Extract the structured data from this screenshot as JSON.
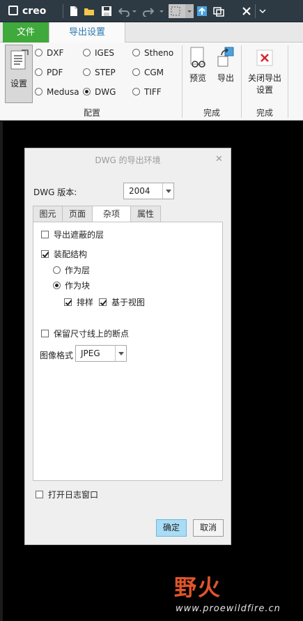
{
  "app": {
    "name": "creo"
  },
  "ribbon": {
    "tabs": {
      "file": "文件",
      "export_setup": "导出设置"
    },
    "settings_label": "设置",
    "formats": [
      "DXF",
      "IGES",
      "Stheno",
      "PDF",
      "STEP",
      "CGM",
      "Medusa",
      "DWG",
      "TIFF"
    ],
    "selected_format": "DWG",
    "group_config": "配置",
    "preview": "预览",
    "export": "导出",
    "group_finish": "完成",
    "close_export_line1": "关闭导出",
    "close_export_line2": "设置",
    "group_finish2": "完成"
  },
  "dialog": {
    "title": "DWG 的导出环境",
    "version_label": "DWG 版本:",
    "version_value": "2004",
    "tabs": [
      "图元",
      "页面",
      "杂项",
      "属性"
    ],
    "active_tab": "杂项",
    "options": {
      "export_hidden_layers": "导出遮蔽的层",
      "assembly_structure": "装配结构",
      "as_layer": "作为层",
      "as_block": "作为块",
      "layout": "排样",
      "view_based": "基于视图",
      "keep_breaks": "保留尺寸线上的断点",
      "image_format_label": "图像格式",
      "image_format_value": "JPEG"
    },
    "open_log": "打开日志窗口",
    "ok": "确定",
    "cancel": "取消"
  },
  "watermark": {
    "title": "野火",
    "url": "www.proewildfire.cn"
  },
  "colors": {
    "accent_green": "#3fa93c",
    "tab_blue": "#2a7ab0",
    "primary_button": "#a9dcf5",
    "close_icon_red": "#d9262a",
    "watermark": "#e0552a"
  }
}
